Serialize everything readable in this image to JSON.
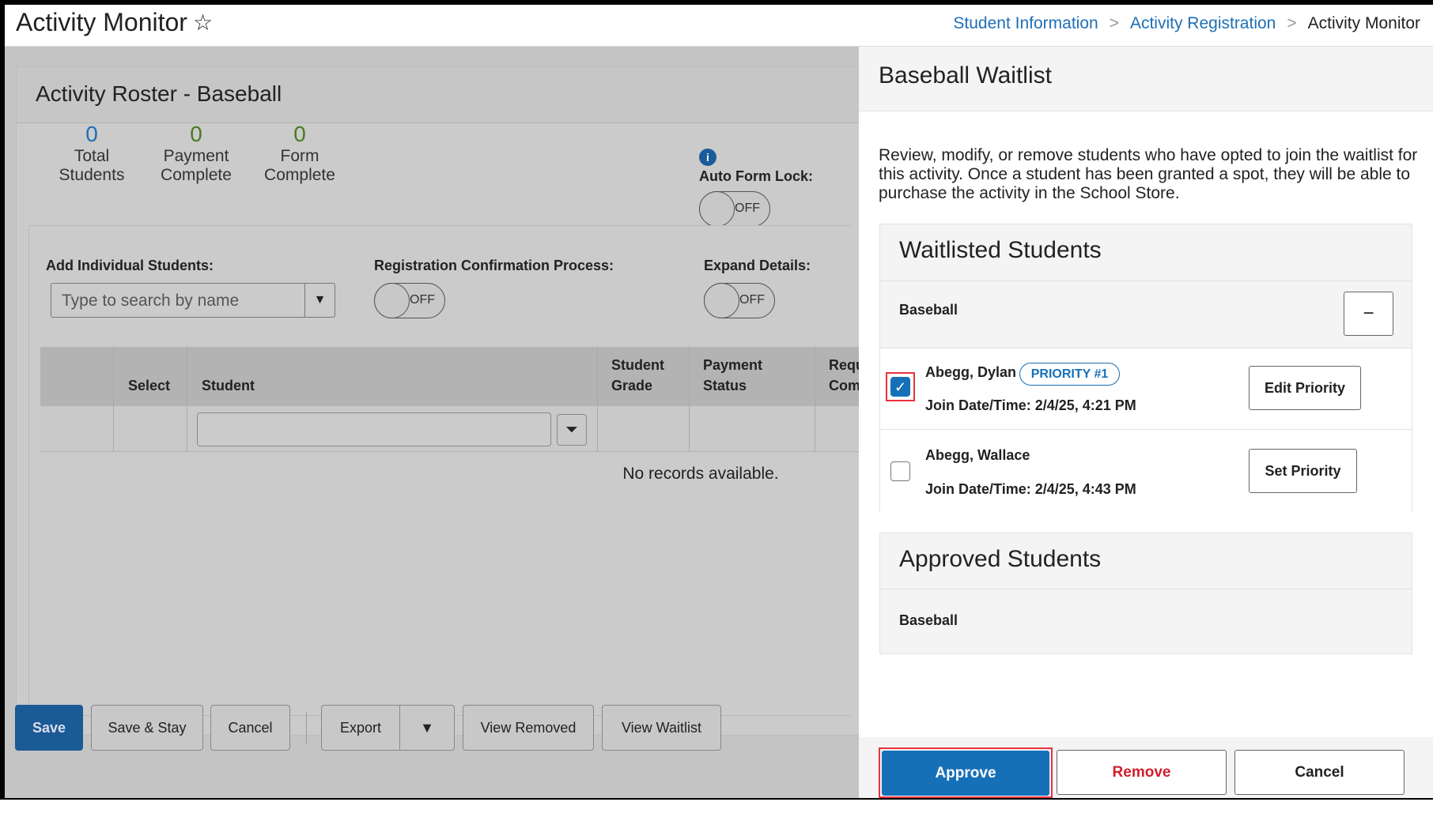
{
  "header": {
    "title": "Activity Monitor",
    "breadcrumb": [
      "Student Information",
      "Activity Registration",
      "Activity Monitor"
    ]
  },
  "roster": {
    "title": "Activity Roster - Baseball",
    "stats": [
      {
        "value": "0",
        "label1": "Total",
        "label2": "Students",
        "color": "#1f6fb5"
      },
      {
        "value": "0",
        "label1": "Payment",
        "label2": "Complete",
        "color": "#4a7a1e"
      },
      {
        "value": "0",
        "label1": "Form",
        "label2": "Complete",
        "color": "#4a7a1e"
      }
    ],
    "auto_form_lock": {
      "label": "Auto Form Lock:",
      "state": "OFF"
    },
    "add_students": {
      "label": "Add Individual Students:",
      "placeholder": "Type to search by name"
    },
    "reg_confirm": {
      "label": "Registration Confirmation Process:",
      "state": "OFF"
    },
    "expand": {
      "label": "Expand Details:",
      "state": "OFF"
    },
    "columns": [
      "Select",
      "Student",
      "Student Grade",
      "Payment Status",
      "Requi Comp"
    ],
    "empty": "No records available.",
    "buttons": {
      "save": "Save",
      "save_stay": "Save & Stay",
      "cancel": "Cancel",
      "export": "Export",
      "view_removed": "View Removed",
      "view_waitlist": "View Waitlist"
    }
  },
  "waitlist": {
    "title": "Baseball Waitlist",
    "description": "Review, modify, or remove students who have opted to join the waitlist for this activity. Once a student has been granted a spot, they will be able to purchase the activity in the School Store.",
    "waitlisted": {
      "heading": "Waitlisted Students",
      "group": "Baseball",
      "students": [
        {
          "name": "Abegg, Dylan",
          "badge": "PRIORITY #1",
          "join": "Join Date/Time: 2/4/25, 4:21 PM",
          "checked": true,
          "action": "Edit Priority"
        },
        {
          "name": "Abegg, Wallace",
          "join": "Join Date/Time: 2/4/25, 4:43 PM",
          "checked": false,
          "action": "Set Priority"
        }
      ]
    },
    "approved": {
      "heading": "Approved Students",
      "group": "Baseball"
    },
    "buttons": {
      "approve": "Approve",
      "remove": "Remove",
      "cancel": "Cancel"
    }
  },
  "colors": {
    "accent": "#1670b8",
    "remove": "#d0202e",
    "highlight": "#e8323c"
  }
}
